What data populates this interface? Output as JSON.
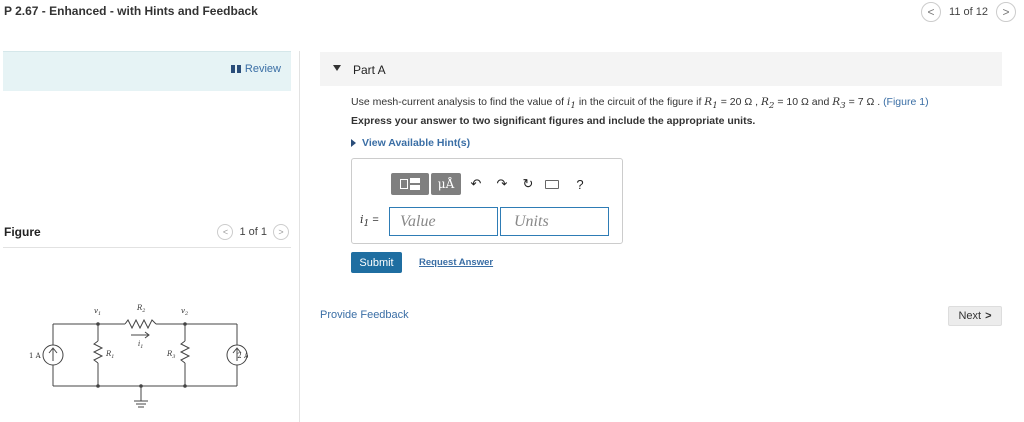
{
  "header": {
    "title": "P 2.67 - Enhanced - with Hints and Feedback",
    "prev_icon": "chevron-left-icon",
    "counter": "11 of 12",
    "next_icon": "chevron-right-icon"
  },
  "left": {
    "review_label": "Review",
    "figure_label": "Figure",
    "figure_counter": "1 of 1",
    "circuit": {
      "v1": "v",
      "v1_sub": "1",
      "v2": "v",
      "v2_sub": "2",
      "r2": "R",
      "r2_sub": "2",
      "r1": "R",
      "r1_sub": "1",
      "r3": "R",
      "r3_sub": "3",
      "i1": "i",
      "i1_sub": "1",
      "src_left": "1 A",
      "src_right": "2 A"
    }
  },
  "part": {
    "title": "Part A",
    "question_pre": "Use mesh-current analysis to find the value of",
    "question_var": "i",
    "question_var_sub": "1",
    "question_mid": "in the circuit of the figure if",
    "r1_text": "R",
    "r1_sub": "1",
    "r1_val": "= 20 Ω ,",
    "r2_text": "R",
    "r2_sub": "2",
    "r2_val": "= 10 Ω and",
    "r3_text": "R",
    "r3_sub": "3",
    "r3_val": "= 7 Ω .",
    "figure_link": "(Figure 1)",
    "instruction": "Express your answer to two significant figures and include the appropriate units.",
    "hints_label": "View Available Hint(s)",
    "toolbar": {
      "template_icon": "template-icon",
      "units_button": "μÅ",
      "undo_icon": "undo-icon",
      "redo_icon": "redo-icon",
      "reset_icon": "reset-icon",
      "keyboard_icon": "keyboard-icon",
      "help": "?"
    },
    "answer_label": "i",
    "answer_label_sub": "1",
    "answer_eq": "=",
    "value_placeholder": "Value",
    "units_placeholder": "Units",
    "submit_label": "Submit",
    "request_label": "Request Answer"
  },
  "footer": {
    "feedback_label": "Provide Feedback",
    "next_label": "Next"
  }
}
